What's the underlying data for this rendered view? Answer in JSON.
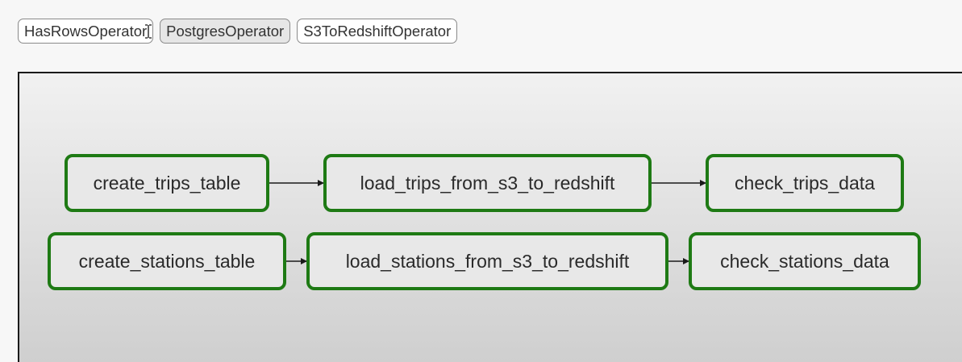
{
  "operator_legend": {
    "items": [
      {
        "label": "HasRowsOperator"
      },
      {
        "label": "PostgresOperator"
      },
      {
        "label": "S3ToRedshiftOperator"
      }
    ]
  },
  "graph": {
    "tasks": {
      "create_trips_table": "create_trips_table",
      "load_trips_from_s3_to_redshift": "load_trips_from_s3_to_redshift",
      "check_trips_data": "check_trips_data",
      "create_stations_table": "create_stations_table",
      "load_stations_from_s3_to_redshift": "load_stations_from_s3_to_redshift",
      "check_stations_data": "check_stations_data"
    },
    "edges": [
      {
        "from": "create_trips_table",
        "to": "load_trips_from_s3_to_redshift"
      },
      {
        "from": "load_trips_from_s3_to_redshift",
        "to": "check_trips_data"
      },
      {
        "from": "create_stations_table",
        "to": "load_stations_from_s3_to_redshift"
      },
      {
        "from": "load_stations_from_s3_to_redshift",
        "to": "check_stations_data"
      }
    ]
  },
  "colors": {
    "task_border": "#1e7a14",
    "task_fill": "#e8e8e8",
    "edge": "#1a1a1a"
  }
}
